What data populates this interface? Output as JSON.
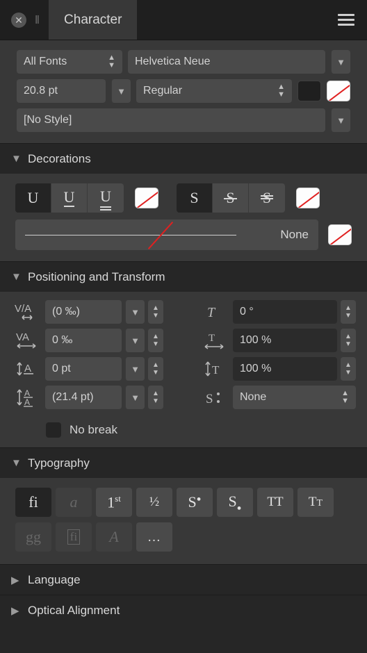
{
  "titlebar": {
    "close_icon": "close-icon",
    "grip_icon": "grip-icon",
    "tab_label": "Character",
    "menu_icon": "hamburger-menu-icon"
  },
  "fonts": {
    "family_filter": {
      "value": "All Fonts",
      "icon": "up-down-stepper-icon"
    },
    "font_family": {
      "value": "Helvetica Neue",
      "icon": "chevron-down-icon"
    },
    "font_size": {
      "value": "20.8 pt",
      "icon": "chevron-down-icon"
    },
    "font_style": {
      "value": "Regular",
      "icon": "up-down-stepper-icon"
    },
    "fill_color": {
      "name": "fill-color-swatch",
      "color": "#1f1f1f"
    },
    "stroke_color": {
      "name": "stroke-color-swatch",
      "color": "none"
    },
    "text_style": {
      "value": "[No Style]",
      "icon": "chevron-down-icon"
    }
  },
  "decorations": {
    "title": "Decorations",
    "twisty": "chevron-down-icon",
    "underline_group": [
      {
        "name": "underline-none",
        "glyph": "U",
        "active": true
      },
      {
        "name": "underline-single",
        "glyph": "U",
        "active": false
      },
      {
        "name": "underline-double",
        "glyph": "U",
        "active": false
      }
    ],
    "underline_color": {
      "name": "underline-color-swatch",
      "color": "none"
    },
    "strikethrough_group": [
      {
        "name": "strikethrough-none",
        "glyph": "S",
        "active": true
      },
      {
        "name": "strikethrough-single",
        "glyph": "S",
        "active": false
      },
      {
        "name": "strikethrough-double",
        "glyph": "S",
        "active": false
      }
    ],
    "strikethrough_color": {
      "name": "strikethrough-color-swatch",
      "color": "none"
    },
    "line_style": {
      "value": "None",
      "preview": "line-with-red-slash"
    },
    "line_style_color": {
      "name": "line-style-color-swatch",
      "color": "none"
    }
  },
  "positioning": {
    "title": "Positioning and Transform",
    "twisty": "chevron-down-icon",
    "left_fields": [
      {
        "icon": "kerning-icon",
        "label": "V/A",
        "value": "(0 ‰)"
      },
      {
        "icon": "tracking-icon",
        "label": "VA",
        "value": "0 ‰"
      },
      {
        "icon": "baseline-shift-icon",
        "label": "A",
        "value": "0 pt"
      },
      {
        "icon": "leading-override-icon",
        "label": "A/A",
        "value": "(21.4 pt)"
      }
    ],
    "right_fields": [
      {
        "icon": "skew-icon",
        "value": "0 °"
      },
      {
        "icon": "horizontal-scale-icon",
        "value": "100 %"
      },
      {
        "icon": "vertical-scale-icon",
        "value": "100 %"
      },
      {
        "icon": "text-position-icon",
        "value": "None"
      }
    ],
    "no_break": {
      "label": "No break",
      "checked": false
    }
  },
  "typography": {
    "title": "Typography",
    "twisty": "chevron-down-icon",
    "row1": [
      {
        "name": "standard-ligatures-button",
        "glyph": "fi",
        "active": true,
        "disabled": false
      },
      {
        "name": "swash-button",
        "glyph": "a",
        "active": false,
        "disabled": true
      },
      {
        "name": "ordinals-button",
        "glyph": "1st",
        "active": false,
        "disabled": false
      },
      {
        "name": "fractions-button",
        "glyph": "½",
        "active": false,
        "disabled": false
      },
      {
        "name": "superscript-button",
        "glyph": "S•",
        "active": false,
        "disabled": false
      },
      {
        "name": "subscript-button",
        "glyph": "S.",
        "active": false,
        "disabled": false
      },
      {
        "name": "all-caps-button",
        "glyph": "TT",
        "active": false,
        "disabled": false
      },
      {
        "name": "small-caps-button",
        "glyph": "TT",
        "active": false,
        "disabled": false
      }
    ],
    "row2": [
      {
        "name": "alternate-glyphs-button",
        "glyph": "gg",
        "active": false,
        "disabled": true
      },
      {
        "name": "discretionary-ligatures-button",
        "glyph": "fi",
        "active": false,
        "disabled": true
      },
      {
        "name": "titling-alternates-button",
        "glyph": "A",
        "active": false,
        "disabled": true
      },
      {
        "name": "more-typography-button",
        "glyph": "…",
        "active": false,
        "disabled": false
      }
    ]
  },
  "collapsed_sections": [
    {
      "title": "Language",
      "twisty": "chevron-right-icon"
    },
    {
      "title": "Optical Alignment",
      "twisty": "chevron-right-icon"
    }
  ]
}
